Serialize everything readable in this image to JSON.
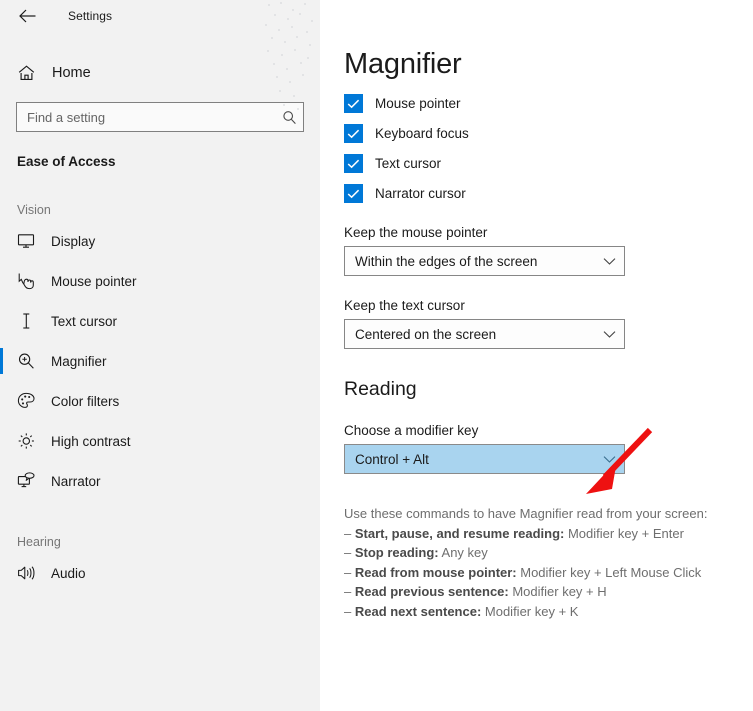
{
  "window": {
    "app_title": "Settings",
    "back_icon": "back-arrow-icon"
  },
  "sidebar": {
    "home": {
      "label": "Home",
      "icon": "home-icon"
    },
    "search": {
      "placeholder": "Find a setting",
      "value": "",
      "icon": "search-icon"
    },
    "section_title": "Ease of Access",
    "groups": [
      {
        "label": "Vision",
        "items": [
          {
            "label": "Display",
            "icon": "monitor-icon",
            "selected": false
          },
          {
            "label": "Mouse pointer",
            "icon": "mouse-pointer-icon",
            "selected": false
          },
          {
            "label": "Text cursor",
            "icon": "text-cursor-icon",
            "selected": false
          },
          {
            "label": "Magnifier",
            "icon": "magnifier-icon",
            "selected": true
          },
          {
            "label": "Color filters",
            "icon": "palette-icon",
            "selected": false
          },
          {
            "label": "High contrast",
            "icon": "brightness-icon",
            "selected": false
          },
          {
            "label": "Narrator",
            "icon": "narrator-icon",
            "selected": false
          }
        ]
      },
      {
        "label": "Hearing",
        "items": [
          {
            "label": "Audio",
            "icon": "speaker-icon",
            "selected": false
          }
        ]
      }
    ]
  },
  "main": {
    "title": "Magnifier",
    "checkboxes": [
      {
        "label": "Mouse pointer",
        "checked": true
      },
      {
        "label": "Keyboard focus",
        "checked": true
      },
      {
        "label": "Text cursor",
        "checked": true
      },
      {
        "label": "Narrator cursor",
        "checked": true
      }
    ],
    "mouse_pointer_field": {
      "label": "Keep the mouse pointer",
      "value": "Within the edges of the screen"
    },
    "text_cursor_field": {
      "label": "Keep the text cursor",
      "value": "Centered on the screen"
    },
    "reading": {
      "heading": "Reading",
      "modifier_field": {
        "label": "Choose a modifier key",
        "value": "Control + Alt",
        "highlighted": true
      },
      "commands_intro": "Use these commands to have Magnifier read from your screen:",
      "commands": [
        {
          "dash": "– ",
          "name": "Start, pause, and resume reading:",
          "keys": " Modifier key + Enter"
        },
        {
          "dash": "– ",
          "name": "Stop reading:",
          "keys": " Any key"
        },
        {
          "dash": "– ",
          "name": "Read from mouse pointer:",
          "keys": " Modifier key + Left Mouse Click"
        },
        {
          "dash": "– ",
          "name": "Read previous sentence:",
          "keys": " Modifier key + H"
        },
        {
          "dash": "– ",
          "name": "Read next sentence:",
          "keys": " Modifier key + K"
        }
      ]
    }
  },
  "annotation": {
    "arrow": {
      "name": "red-arrow-annotation",
      "color": "#ee1111"
    }
  },
  "colors": {
    "accent": "#0078d7",
    "sidebar_bg": "#f2f2f2",
    "highlight_fill": "#a9d4ef",
    "arrow_red": "#ee1111"
  }
}
